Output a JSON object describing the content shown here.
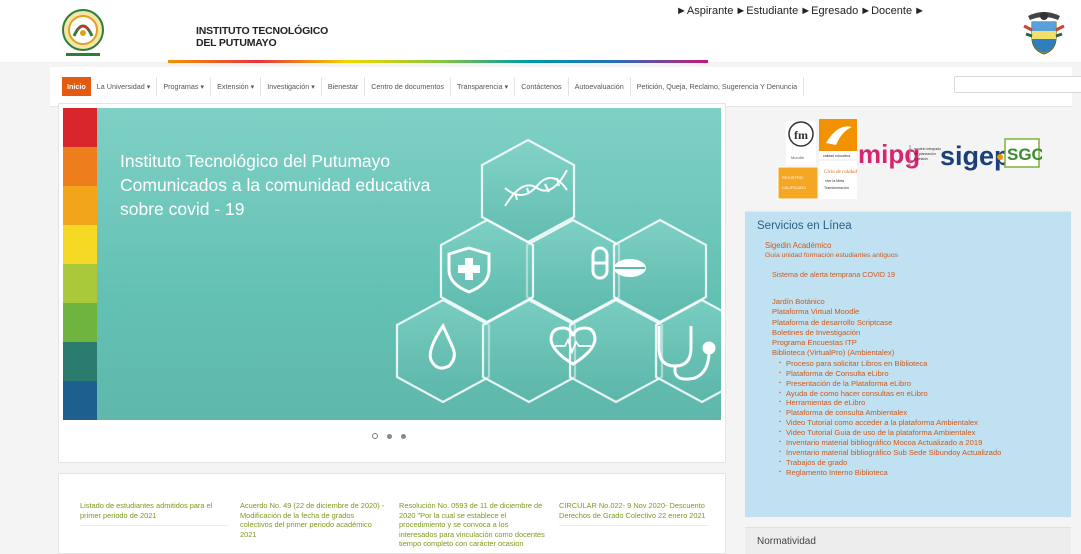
{
  "header": {
    "institution_line1": "INSTITUTO TECNOLÓGICO",
    "institution_line2": "DEL PUTUMAYO",
    "roles": [
      "►Aspirante ",
      "►Estudiante",
      "►Egresado ",
      "►Docente",
      "►"
    ]
  },
  "nav": {
    "items": [
      {
        "label": "Inicio"
      },
      {
        "label": "La Universidad ▾"
      },
      {
        "label": "Programas ▾"
      },
      {
        "label": "Extensión ▾"
      },
      {
        "label": "Investigación ▾"
      },
      {
        "label": "Bienestar"
      },
      {
        "label": "Centro de documentos"
      },
      {
        "label": "Transparencia ▾"
      },
      {
        "label": "Contáctenos"
      },
      {
        "label": "Autoevaluación"
      },
      {
        "label": "Petición, Queja, Reclamo, Sugerencia Y Denuncia"
      }
    ],
    "search_placeholder": "",
    "colors": {
      "active": "#e35b13"
    }
  },
  "slider": {
    "title": "Instituto Tecnológico del Putumayo Comunicados a la comunidad educativa sobre covid - 19",
    "stripe_colors": [
      "#d9262a",
      "#ee7d1b",
      "#f2a519",
      "#f5d824",
      "#a9c93b",
      "#6fb43e",
      "#2c7b6f",
      "#1d5f8f"
    ],
    "dots": 3,
    "active_dot": 0
  },
  "news": [
    {
      "text": "Listado de estudiantes admitidos para el primer periodo de 2021"
    },
    {
      "text": "Acuerdo No. 49 (22 de diciembre de 2020) - Modificación de la fecha de grados colectivos del primer periodo académico 2021"
    },
    {
      "text": "Resolución No. 0593 de 11 de diciembre de 2020 \"Por la cual se establece el procedimiento y se convoca a los interesados para vinculación como docentes tiempo completo con carácter ocasion"
    },
    {
      "text": "CIRCULAR No.022- 9 Nov 2020- Descuento Derechos de Grado Colectivo 22 enero 2021"
    }
  ],
  "partners": {
    "mipg": "mipg",
    "sigep": "sigep",
    "sgc": "SGC"
  },
  "services": {
    "title": "Servicios en Línea",
    "group1": [
      "Sigedin Académico",
      "Guía unidad formación estudiantes antiguos"
    ],
    "group2": [
      "Sistema de alerta temprana COVID 19"
    ],
    "group3": [
      "Jardín Botánico",
      "Plataforma Virtual Moodle",
      "Plataforma de desarrollo Scriptcase",
      "Boletines de Investigación",
      "Programa Encuestas ITP",
      "Biblioteca (VirtualPro) (Ambientalex)"
    ],
    "library": [
      "Proceso para solicitar Libros en Biblioteca",
      "Plataforma de Consulta eLibro",
      "Presentación de la Plataforma eLibro",
      "Ayuda de como hacer consultas en eLibro",
      "Herramientas de eLibro",
      "Plataforma de consulta Ambientalex",
      "Video Tutorial como acceder a la plataforma Ambientalex",
      "Video Tutorial Guia de uso de la plataforma Ambientalex",
      "Inventario material bibliográfico Mocoa Actualizado a 2019",
      "Inventario material bibliográfico Sub Sede Sibundoy Actualizado",
      "Trabajos de grado",
      "Reglamento Interno Biblioteca"
    ]
  },
  "normatividad": {
    "title": "Normatividad"
  }
}
